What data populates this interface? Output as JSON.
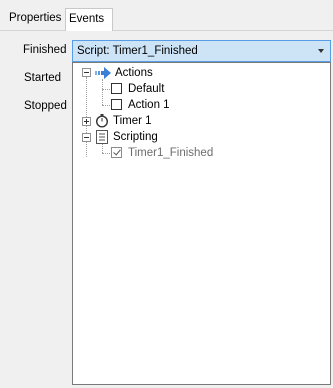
{
  "tabs": [
    {
      "label": "Properties"
    },
    {
      "label": "Events"
    }
  ],
  "events": {
    "finished_label": "Finished",
    "started_label": "Started",
    "stopped_label": "Stopped",
    "finished_value": "Script: Timer1_Finished"
  },
  "tree": {
    "actions": "Actions",
    "default": "Default",
    "action1": "Action 1",
    "timer1": "Timer 1",
    "scripting": "Scripting",
    "timer1_finished": "Timer1_Finished"
  },
  "colors": {
    "combo_bg": "#cde4f7",
    "combo_border": "#569de5",
    "arrow_icon": "#3c7fd6"
  }
}
